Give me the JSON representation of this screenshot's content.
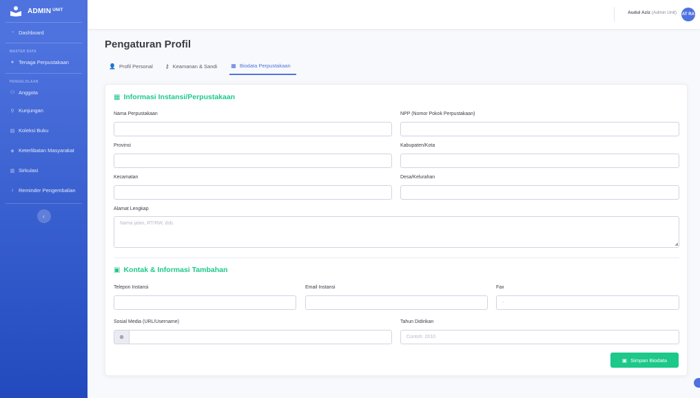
{
  "sidebar": {
    "brand": "ADMIN",
    "brand_sup": "UNIT",
    "items": [
      {
        "label": "Dashboard",
        "icon": "dashboard-icon"
      },
      {
        "heading": "MASTER DATA"
      },
      {
        "label": "Tenaga Perpustakaan",
        "icon": "user-icon"
      },
      {
        "heading": "PENGELOLAAN"
      },
      {
        "label": "Anggota",
        "icon": "users-icon"
      },
      {
        "label": "Kunjungan",
        "icon": "walk-icon"
      },
      {
        "label": "Koleksi Buku",
        "icon": "book-icon"
      },
      {
        "label": "Keterlibatan Masyarakat",
        "icon": "handshake-icon"
      },
      {
        "label": "Sirkulasi",
        "icon": "exchange-icon"
      },
      {
        "label": "Reminder Pengembalian",
        "icon": "bell-icon"
      }
    ]
  },
  "topbar": {
    "user_name": "Audul Aziz",
    "user_role": "(Admin Unit)",
    "avatar_initials": "AT RA"
  },
  "page": {
    "title": "Pengaturan Profil",
    "tabs": [
      {
        "label": "Profil Personal",
        "icon": "user-edit-icon"
      },
      {
        "label": "Keamanan & Sandi",
        "icon": "key-icon"
      },
      {
        "label": "Biodata Perpustakaan",
        "icon": "building-icon",
        "active": true
      }
    ]
  },
  "form": {
    "section1_title": "Informasi Instansi/Perpustakaan",
    "nama_label": "Nama Perpustakaan",
    "npp_label": "NPP (Nomor Pokok Perpustakaan)",
    "provinsi_label": "Provinsi",
    "kabupaten_label": "Kabupaten/Kota",
    "kecamatan_label": "Kecamatan",
    "desa_label": "Desa/Kelurahan",
    "alamat_label": "Alamat Lengkap",
    "alamat_placeholder": "Nama jalan, RT/RW, dsb.",
    "section2_title": "Kontak & Informasi Tambahan",
    "telepon_label": "Telepon Instansi",
    "email_label": "Email Instansi",
    "fax_label": "Fax",
    "fax_placeholder": "-",
    "sosmed_label": "Sosial Media (URL/Username)",
    "tahun_label": "Tahun Didirikan",
    "tahun_placeholder": "Contoh: 2010",
    "save_label": "Simpan Biodata"
  },
  "colors": {
    "primary": "#4e73df",
    "success": "#1cc88a"
  }
}
